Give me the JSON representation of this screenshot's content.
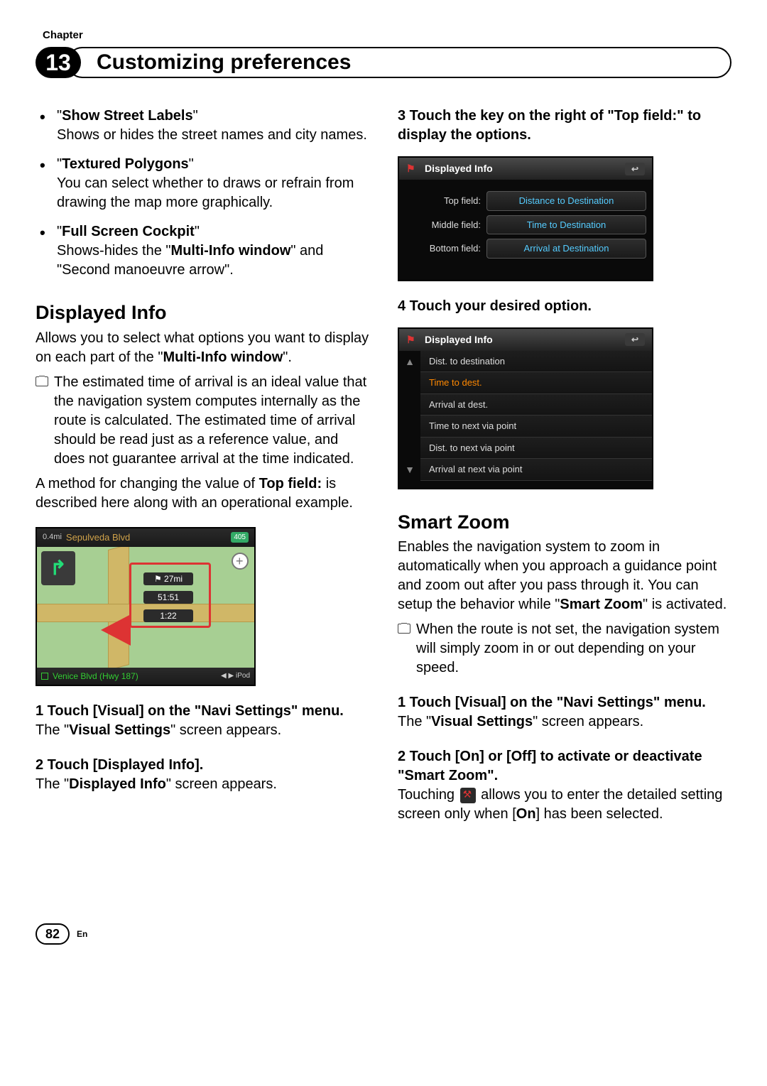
{
  "chapter_label": "Chapter",
  "chapter_number": "13",
  "chapter_title": "Customizing preferences",
  "left": {
    "bullets": [
      {
        "title": "Show Street Labels",
        "desc": "Shows or hides the street names and city names."
      },
      {
        "title": "Textured Polygons",
        "desc": "You can select whether to draws or refrain from drawing the map more graphically."
      },
      {
        "title": "Full Screen Cockpit",
        "desc_pre": "Shows-hides the \"",
        "desc_b": "Multi-Info window",
        "desc_post": "\" and \"Second manoeuvre arrow\"."
      }
    ],
    "section_title": "Displayed Info",
    "intro_pre": "Allows you to select what options you want to display on each part of the \"",
    "intro_b": "Multi-Info window",
    "intro_post": "\".",
    "note": "The estimated time of arrival is an ideal value that the navigation system computes internally as the route is calculated. The estimated time of arrival should be read just as a reference value, and does not guarantee arrival at the time indicated.",
    "method_pre": "A method for changing the value of ",
    "method_b": "Top field:",
    "method_post": " is described here along with an operational example.",
    "map": {
      "dist": "0.4mi",
      "street_top": "Sepulveda Blvd",
      "shield": "405",
      "badge1": "⚑ 27mi",
      "badge2": "51:51",
      "badge3": "1:22",
      "street_bot": "Venice Blvd (Hwy 187)",
      "device": "iPod"
    },
    "step1_h": "1   Touch [Visual] on the \"Navi Settings\" menu.",
    "step1_d_pre": "The \"",
    "step1_d_b": "Visual Settings",
    "step1_d_post": "\" screen appears.",
    "step2_h": "2   Touch [Displayed Info].",
    "step2_d_pre": "The \"",
    "step2_d_b": "Displayed Info",
    "step2_d_post": "\" screen appears."
  },
  "right": {
    "step3_h": "3   Touch the key on the right of \"Top field:\" to display the options.",
    "screen1": {
      "title": "Displayed Info",
      "rows": [
        {
          "label": "Top field:",
          "value": "Distance to Destination"
        },
        {
          "label": "Middle field:",
          "value": "Time to Destination"
        },
        {
          "label": "Bottom field:",
          "value": "Arrival at Destination"
        }
      ]
    },
    "step4_h": "4   Touch your desired option.",
    "screen2": {
      "title": "Displayed Info",
      "items": [
        {
          "label": "Dist. to destination",
          "sel": false
        },
        {
          "label": "Time to dest.",
          "sel": true
        },
        {
          "label": "Arrival at dest.",
          "sel": false
        },
        {
          "label": "Time to next via point",
          "sel": false
        },
        {
          "label": "Dist. to next via point",
          "sel": false
        },
        {
          "label": "Arrival at next via point",
          "sel": false
        }
      ]
    },
    "section_title": "Smart Zoom",
    "intro_pre": "Enables the navigation system to zoom in automatically when you approach a guidance point and zoom out after you pass through it. You can setup the behavior while \"",
    "intro_b": "Smart Zoom",
    "intro_post": "\" is activated.",
    "note": "When the route is not set, the navigation system will simply zoom in or out depending on your speed.",
    "step1_h": "1   Touch [Visual] on the \"Navi Settings\" menu.",
    "step1_d_pre": "The \"",
    "step1_d_b": "Visual Settings",
    "step1_d_post": "\" screen appears.",
    "step2_h": "2   Touch [On] or [Off] to activate or deactivate \"Smart Zoom\".",
    "step2_d_pre": "Touching ",
    "step2_d_mid": " allows you to enter the detailed setting screen only when [",
    "step2_d_b": "On",
    "step2_d_post": "] has been selected."
  },
  "footer": {
    "page": "82",
    "lang": "En"
  }
}
